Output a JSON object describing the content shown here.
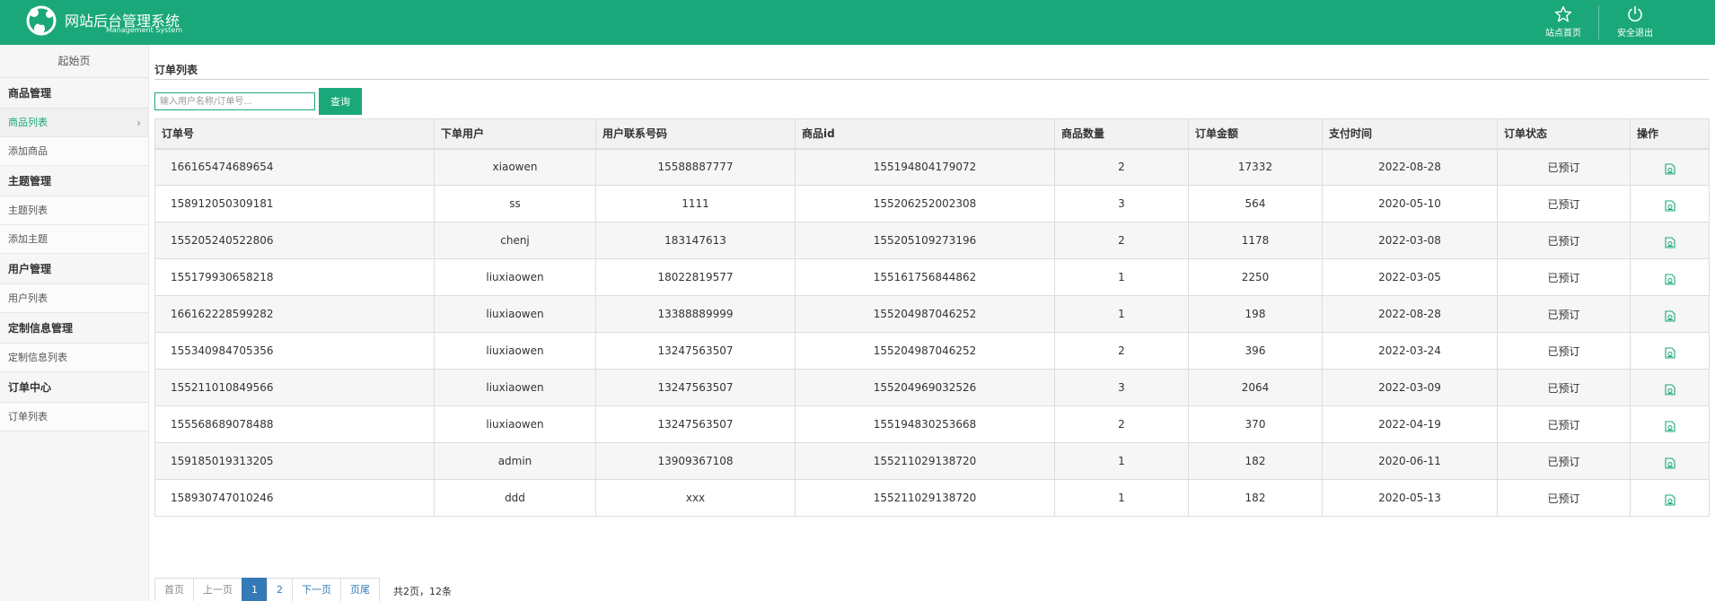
{
  "header": {
    "brand_title": "网站后台管理系统",
    "brand_subtitle": "Management System",
    "site_home": "站点首页",
    "logout": "安全退出",
    "color": "#1aa87a"
  },
  "sidebar": {
    "home": "起始页",
    "groups": [
      {
        "title": "商品管理",
        "items": [
          "商品列表",
          "添加商品"
        ]
      },
      {
        "title": "主题管理",
        "items": [
          "主题列表",
          "添加主题"
        ]
      },
      {
        "title": "用户管理",
        "items": [
          "用户列表"
        ]
      },
      {
        "title": "定制信息管理",
        "items": [
          "定制信息列表"
        ]
      },
      {
        "title": "订单中心",
        "items": [
          "订单列表"
        ]
      }
    ],
    "active_item": "商品列表"
  },
  "main": {
    "title": "订单列表",
    "search_placeholder": "输入用户名称/订单号...",
    "search_button": "查询"
  },
  "table": {
    "columns": [
      "订单号",
      "下单用户",
      "用户联系号码",
      "商品id",
      "商品数量",
      "订单金额",
      "支付时间",
      "订单状态",
      "操作"
    ],
    "rows": [
      [
        "166165474689654",
        "xiaowen",
        "15588887777",
        "155194804179072",
        "2",
        "17332",
        "2022-08-28",
        "已预订"
      ],
      [
        "158912050309181",
        "ss",
        "1111",
        "155206252002308",
        "3",
        "564",
        "2020-05-10",
        "已预订"
      ],
      [
        "155205240522806",
        "chenj",
        "183147613",
        "155205109273196",
        "2",
        "1178",
        "2022-03-08",
        "已预订"
      ],
      [
        "155179930658218",
        "liuxiaowen",
        "18022819577",
        "155161756844862",
        "1",
        "2250",
        "2022-03-05",
        "已预订"
      ],
      [
        "166162228599282",
        "liuxiaowen",
        "13388889999",
        "155204987046252",
        "1",
        "198",
        "2022-08-28",
        "已预订"
      ],
      [
        "155340984705356",
        "liuxiaowen",
        "13247563507",
        "155204987046252",
        "2",
        "396",
        "2022-03-24",
        "已预订"
      ],
      [
        "155211010849566",
        "liuxiaowen",
        "13247563507",
        "155204969032526",
        "3",
        "2064",
        "2022-03-09",
        "已预订"
      ],
      [
        "155568689078488",
        "liuxiaowen",
        "13247563507",
        "155194830253668",
        "2",
        "370",
        "2022-04-19",
        "已预订"
      ],
      [
        "159185019313205",
        "admin",
        "13909367108",
        "155211029138720",
        "1",
        "182",
        "2020-06-11",
        "已预订"
      ],
      [
        "158930747010246",
        "ddd",
        "xxx",
        "155211029138720",
        "1",
        "182",
        "2020-05-13",
        "已预订"
      ]
    ],
    "action_icon": "edit-doc-icon"
  },
  "pagination": {
    "first": "首页",
    "prev": "上一页",
    "pages": [
      "1",
      "2"
    ],
    "current": "1",
    "next": "下一页",
    "last": "页尾",
    "info": "共2页，12条"
  }
}
